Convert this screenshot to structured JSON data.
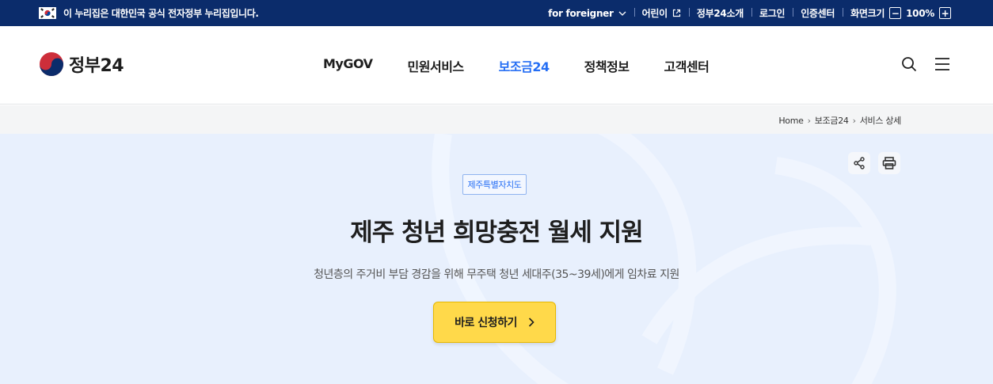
{
  "topbar": {
    "notice": "이 누리집은 대한민국 공식 전자정부 누리집입니다.",
    "links": [
      {
        "label": "for foreigner",
        "icon": "chevron-down-icon"
      },
      {
        "label": "어린이",
        "icon": "external-link-icon"
      },
      {
        "label": "정부24소개"
      },
      {
        "label": "로그인"
      },
      {
        "label": "인증센터"
      }
    ],
    "zoom": {
      "label": "화면크기",
      "value": "100%",
      "minus": "−",
      "plus": "+"
    }
  },
  "header": {
    "logo_text": "정부24",
    "menu": [
      "MyGOV",
      "민원서비스",
      "보조금24",
      "정책정보",
      "고객센터"
    ],
    "active_menu": "보조금24"
  },
  "breadcrumb": [
    "Home",
    "보조금24",
    "서비스 상세"
  ],
  "hero": {
    "region": "제주특별자치도",
    "title": "제주 청년 희망충전 월세 지원",
    "description": "청년층의 주거비 부담 경감을 위해 무주택 청년 세대주(35~39세)에게 임차료 지원",
    "apply_label": "바로 신청하기"
  },
  "colors": {
    "topbar": "#0b2c6b",
    "accent": "#256ef4",
    "hero_bg": "#e8f0fd",
    "apply_button": "#ffd94a"
  }
}
